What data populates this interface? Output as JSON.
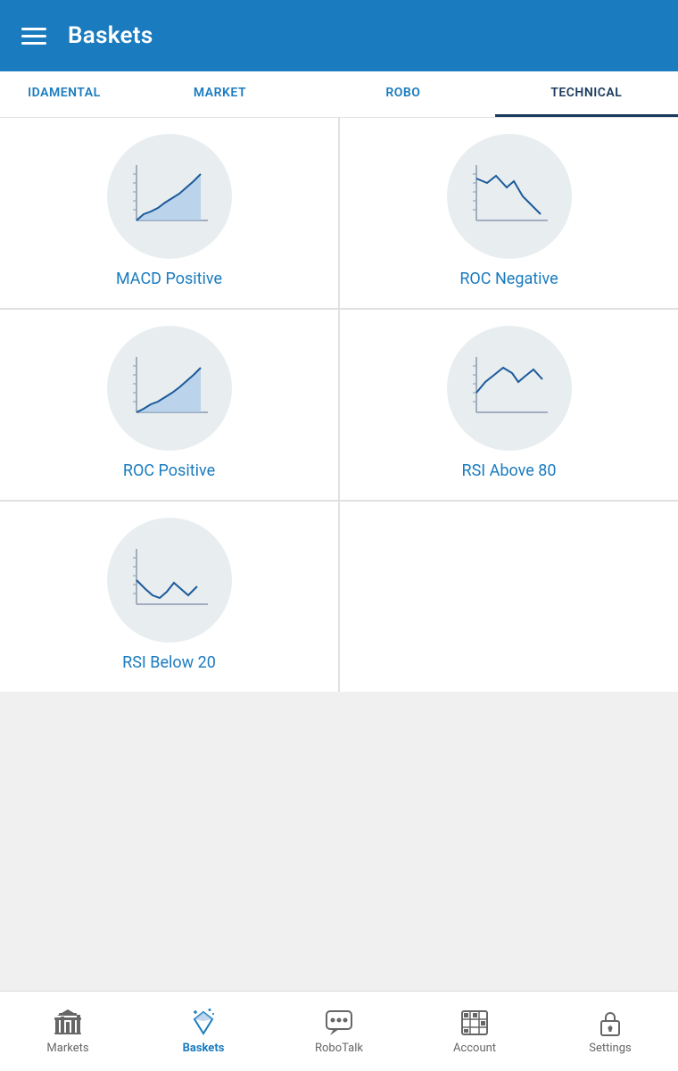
{
  "header": {
    "title": "Baskets",
    "menu_icon_label": "menu"
  },
  "tabs": [
    {
      "id": "fundamental",
      "label": "IDAMENTAL",
      "active": false
    },
    {
      "id": "market",
      "label": "MARKET",
      "active": false
    },
    {
      "id": "robo",
      "label": "ROBO",
      "active": false
    },
    {
      "id": "technical",
      "label": "TECHNICAL",
      "active": true
    }
  ],
  "cards": [
    {
      "id": "macd-positive",
      "label": "MACD Positive",
      "chart_type": "macd_positive"
    },
    {
      "id": "roc-negative",
      "label": "ROC Negative",
      "chart_type": "roc_negative"
    },
    {
      "id": "roc-positive",
      "label": "ROC Positive",
      "chart_type": "roc_positive"
    },
    {
      "id": "rsi-above-80",
      "label": "RSI Above 80",
      "chart_type": "rsi_above_80"
    },
    {
      "id": "rsi-below-20",
      "label": "RSI Below 20",
      "chart_type": "rsi_below_20"
    },
    {
      "id": "empty",
      "label": "",
      "chart_type": "empty"
    }
  ],
  "bottom_nav": [
    {
      "id": "markets",
      "label": "Markets",
      "icon": "markets",
      "active": false
    },
    {
      "id": "baskets",
      "label": "Baskets",
      "icon": "baskets",
      "active": true
    },
    {
      "id": "robotalk",
      "label": "RoboTalk",
      "icon": "robotalk",
      "active": false
    },
    {
      "id": "account",
      "label": "Account",
      "icon": "account",
      "active": false
    },
    {
      "id": "settings",
      "label": "Settings",
      "icon": "settings",
      "active": false
    }
  ],
  "colors": {
    "brand_blue": "#1a7bbf",
    "dark_blue": "#1a3a5c",
    "active_tab_indicator": "#1a3a5c",
    "circle_bg": "#e8edf0",
    "chart_blue_fill": "#a8c8e8",
    "chart_blue_line": "#1a5a9a",
    "chart_axis": "#8a9ab0"
  }
}
